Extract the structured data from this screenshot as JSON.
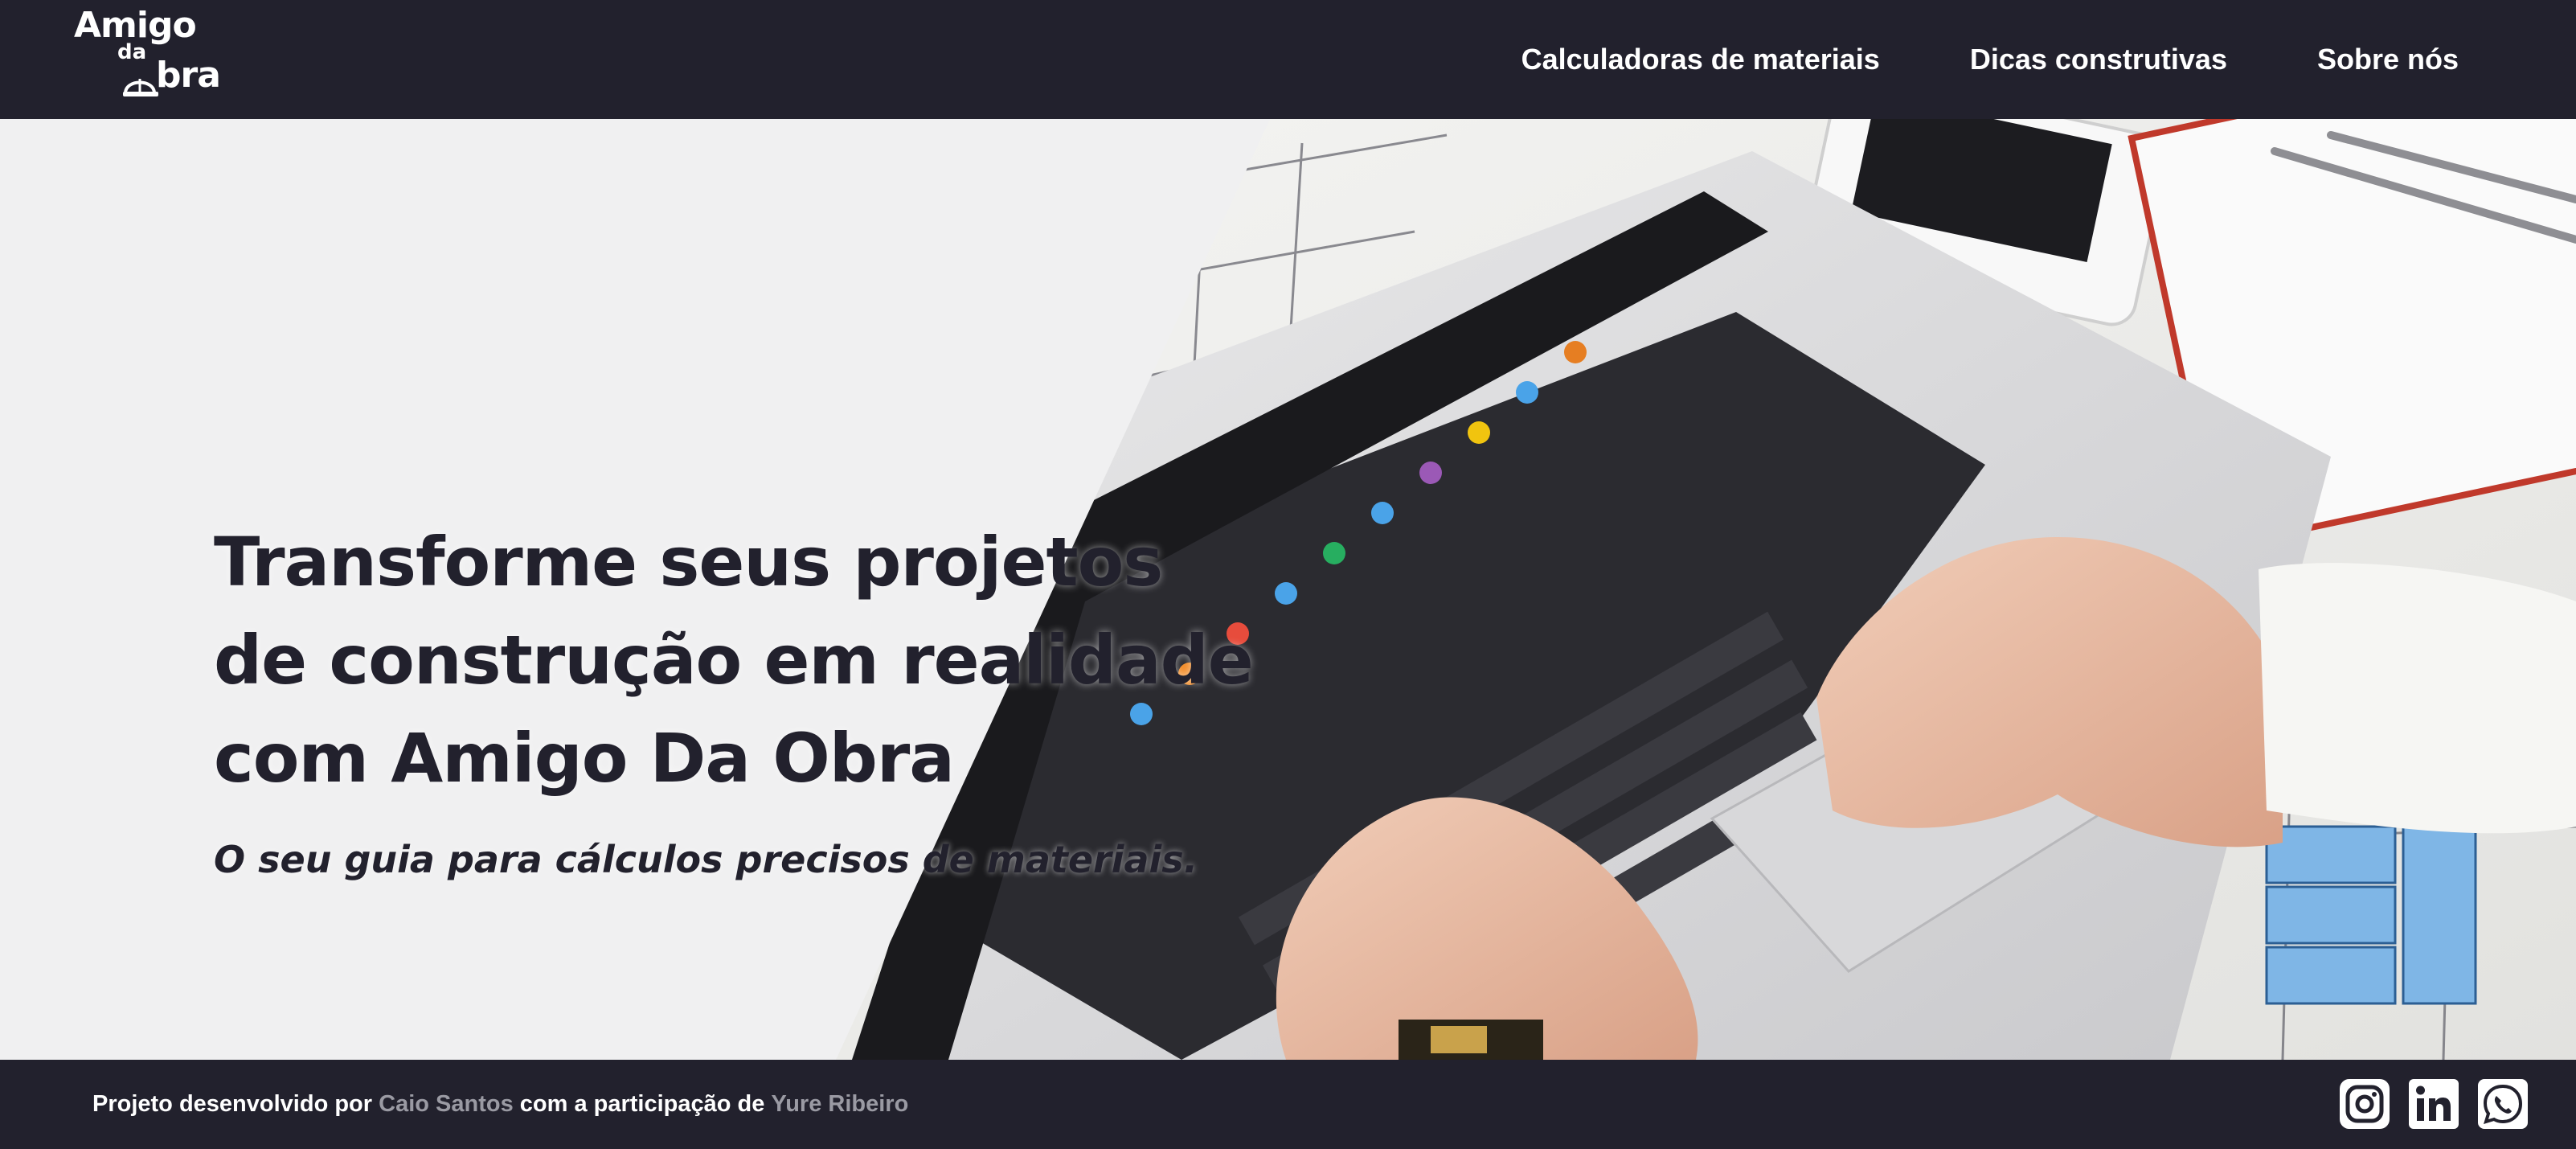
{
  "header": {
    "logo": {
      "line1": "Amigo",
      "line2": "da",
      "line3": "bra"
    },
    "nav": [
      {
        "label": "Calculadoras de materiais"
      },
      {
        "label": "Dicas construtivas"
      },
      {
        "label": "Sobre nós"
      }
    ]
  },
  "hero": {
    "headline_lines": [
      "Transforme seus projetos",
      "de construção em realidade",
      "com Amigo Da Obra"
    ],
    "subline": "O seu guia para cálculos precisos de materiais.",
    "image_name": "laptop-blueprint-hero-image"
  },
  "footer": {
    "text_prefix": "Projeto desenvolvido por ",
    "author": "Caio Santos",
    "text_middle": " com a participação de ",
    "collaborator": "Yure Ribeiro",
    "social_icons": [
      "instagram-icon",
      "linkedin-icon",
      "whatsapp-icon"
    ]
  },
  "colors": {
    "dark": "#22212d",
    "hero_background": "#f0f0f1",
    "footer_name": "#9a9aa3",
    "white": "#ffffff"
  }
}
